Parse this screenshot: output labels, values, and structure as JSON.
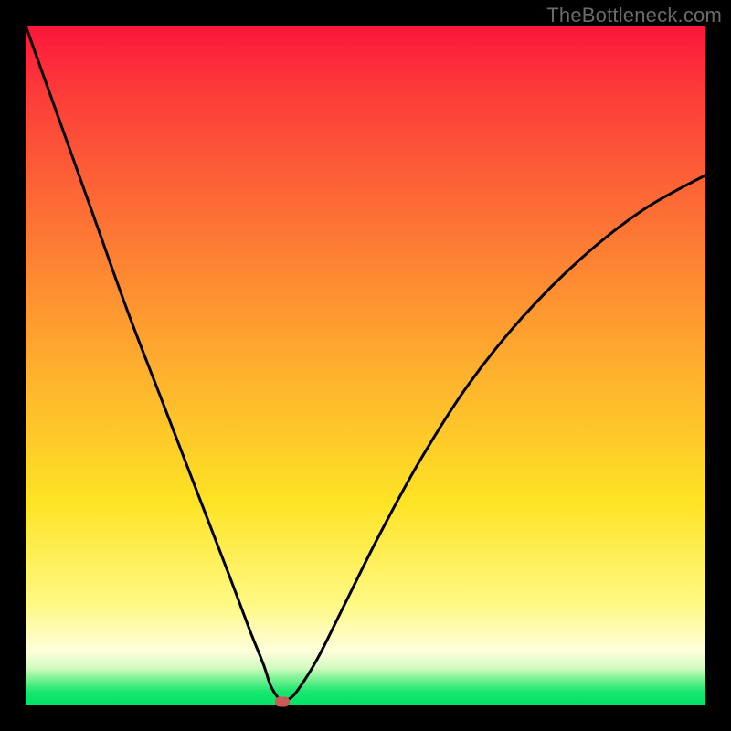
{
  "watermark": "TheBottleneck.com",
  "chart_data": {
    "type": "line",
    "title": "",
    "xlabel": "",
    "ylabel": "",
    "xlim": [
      0,
      100
    ],
    "ylim": [
      0,
      100
    ],
    "series": [
      {
        "name": "curve",
        "x": [
          0,
          5,
          10,
          15,
          20,
          25,
          30,
          33,
          35,
          36,
          37,
          37.5,
          38.5,
          40,
          43,
          47,
          52,
          58,
          65,
          73,
          82,
          91,
          100
        ],
        "y": [
          100,
          86,
          72,
          58,
          45,
          32,
          19,
          11,
          6,
          3,
          1.3,
          0.8,
          0.8,
          2.2,
          7,
          15,
          25,
          36,
          47,
          57,
          66,
          73,
          78
        ]
      }
    ],
    "marker": {
      "x": 37.8,
      "y": 0.6
    },
    "colors": {
      "curve": "#000000",
      "marker": "#c95a58",
      "gradient_top": "#fb163a",
      "gradient_bottom": "#00e466"
    }
  }
}
